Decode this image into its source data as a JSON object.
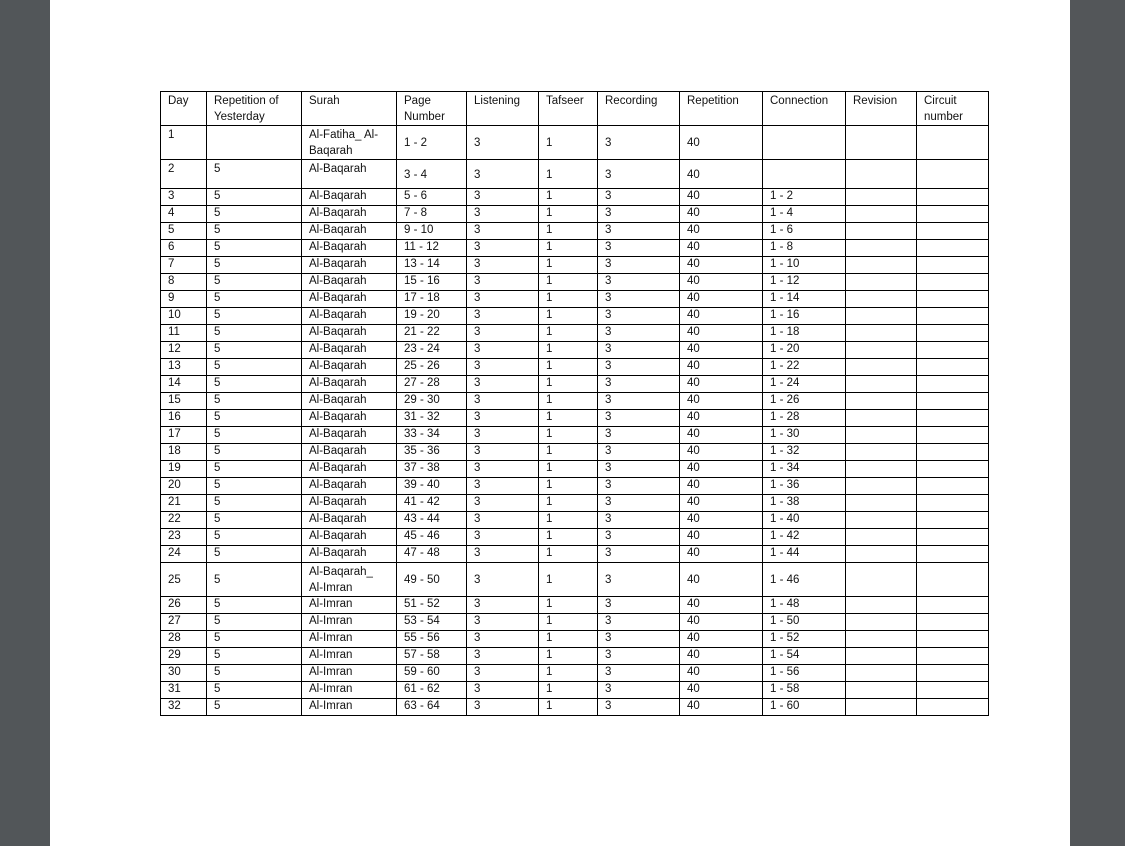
{
  "table": {
    "headers": [
      "Day",
      "Repetition of Yesterday",
      "Surah",
      "Page Number",
      "Listening",
      "Tafseer",
      "Recording",
      "Repetition",
      "Connection",
      "Revision",
      "Circuit number"
    ],
    "rows": [
      [
        "1",
        "",
        "Al-Fatiha_ Al-Baqarah",
        "1 - 2",
        "3",
        "1",
        "3",
        "40",
        "",
        "",
        ""
      ],
      [
        "2",
        "5",
        "Al-Baqarah",
        "3 - 4",
        "3",
        "1",
        "3",
        "40",
        "",
        "",
        ""
      ],
      [
        "3",
        "5",
        "Al-Baqarah",
        "5 - 6",
        "3",
        "1",
        "3",
        "40",
        "1 - 2",
        "",
        ""
      ],
      [
        "4",
        "5",
        "Al-Baqarah",
        "7 - 8",
        "3",
        "1",
        "3",
        "40",
        "1 - 4",
        "",
        ""
      ],
      [
        "5",
        "5",
        "Al-Baqarah",
        "9 - 10",
        "3",
        "1",
        "3",
        "40",
        "1 - 6",
        "",
        ""
      ],
      [
        "6",
        "5",
        "Al-Baqarah",
        "11 - 12",
        "3",
        "1",
        "3",
        "40",
        "1 - 8",
        "",
        ""
      ],
      [
        "7",
        "5",
        "Al-Baqarah",
        "13 - 14",
        "3",
        "1",
        "3",
        "40",
        "1 - 10",
        "",
        ""
      ],
      [
        "8",
        "5",
        "Al-Baqarah",
        "15 - 16",
        "3",
        "1",
        "3",
        "40",
        "1 - 12",
        "",
        ""
      ],
      [
        "9",
        "5",
        "Al-Baqarah",
        "17 - 18",
        "3",
        "1",
        "3",
        "40",
        "1 - 14",
        "",
        ""
      ],
      [
        "10",
        "5",
        "Al-Baqarah",
        "19 - 20",
        "3",
        "1",
        "3",
        "40",
        "1 - 16",
        "",
        ""
      ],
      [
        "11",
        "5",
        "Al-Baqarah",
        "21 - 22",
        "3",
        "1",
        "3",
        "40",
        "1 - 18",
        "",
        ""
      ],
      [
        "12",
        "5",
        "Al-Baqarah",
        "23 - 24",
        "3",
        "1",
        "3",
        "40",
        "1 - 20",
        "",
        ""
      ],
      [
        "13",
        "5",
        "Al-Baqarah",
        "25 - 26",
        "3",
        "1",
        "3",
        "40",
        "1 - 22",
        "",
        ""
      ],
      [
        "14",
        "5",
        "Al-Baqarah",
        "27 - 28",
        "3",
        "1",
        "3",
        "40",
        "1 - 24",
        "",
        ""
      ],
      [
        "15",
        "5",
        "Al-Baqarah",
        "29 - 30",
        "3",
        "1",
        "3",
        "40",
        "1 - 26",
        "",
        ""
      ],
      [
        "16",
        "5",
        "Al-Baqarah",
        "31 - 32",
        "3",
        "1",
        "3",
        "40",
        "1 - 28",
        "",
        ""
      ],
      [
        "17",
        "5",
        "Al-Baqarah",
        "33 - 34",
        "3",
        "1",
        "3",
        "40",
        "1 - 30",
        "",
        ""
      ],
      [
        "18",
        "5",
        "Al-Baqarah",
        "35 - 36",
        "3",
        "1",
        "3",
        "40",
        "1 - 32",
        "",
        ""
      ],
      [
        "19",
        "5",
        "Al-Baqarah",
        "37 - 38",
        "3",
        "1",
        "3",
        "40",
        "1 - 34",
        "",
        ""
      ],
      [
        "20",
        "5",
        "Al-Baqarah",
        "39 - 40",
        "3",
        "1",
        "3",
        "40",
        "1 - 36",
        "",
        ""
      ],
      [
        "21",
        "5",
        "Al-Baqarah",
        "41 - 42",
        "3",
        "1",
        "3",
        "40",
        "1 - 38",
        "",
        ""
      ],
      [
        "22",
        "5",
        "Al-Baqarah",
        "43 - 44",
        "3",
        "1",
        "3",
        "40",
        "1 - 40",
        "",
        ""
      ],
      [
        "23",
        "5",
        "Al-Baqarah",
        "45 - 46",
        "3",
        "1",
        "3",
        "40",
        "1 - 42",
        "",
        ""
      ],
      [
        "24",
        "5",
        "Al-Baqarah",
        "47 - 48",
        "3",
        "1",
        "3",
        "40",
        "1 - 44",
        "",
        ""
      ],
      [
        "25",
        "5",
        "Al-Baqarah_ Al-Imran",
        "49 - 50",
        "3",
        "1",
        "3",
        "40",
        "1 - 46",
        "",
        ""
      ],
      [
        "26",
        "5",
        "Al-Imran",
        "51 - 52",
        "3",
        "1",
        "3",
        "40",
        "1 - 48",
        "",
        ""
      ],
      [
        "27",
        "5",
        "Al-Imran",
        "53 - 54",
        "3",
        "1",
        "3",
        "40",
        "1 - 50",
        "",
        ""
      ],
      [
        "28",
        "5",
        "Al-Imran",
        "55 - 56",
        "3",
        "1",
        "3",
        "40",
        "1 - 52",
        "",
        ""
      ],
      [
        "29",
        "5",
        "Al-Imran",
        "57 - 58",
        "3",
        "1",
        "3",
        "40",
        "1 - 54",
        "",
        ""
      ],
      [
        "30",
        "5",
        "Al-Imran",
        "59 - 60",
        "3",
        "1",
        "3",
        "40",
        "1 - 56",
        "",
        ""
      ],
      [
        "31",
        "5",
        "Al-Imran",
        "61 - 62",
        "3",
        "1",
        "3",
        "40",
        "1 - 58",
        "",
        ""
      ],
      [
        "32",
        "5",
        "Al-Imran",
        "63 - 64",
        "3",
        "1",
        "3",
        "40",
        "1 - 60",
        "",
        ""
      ]
    ]
  }
}
